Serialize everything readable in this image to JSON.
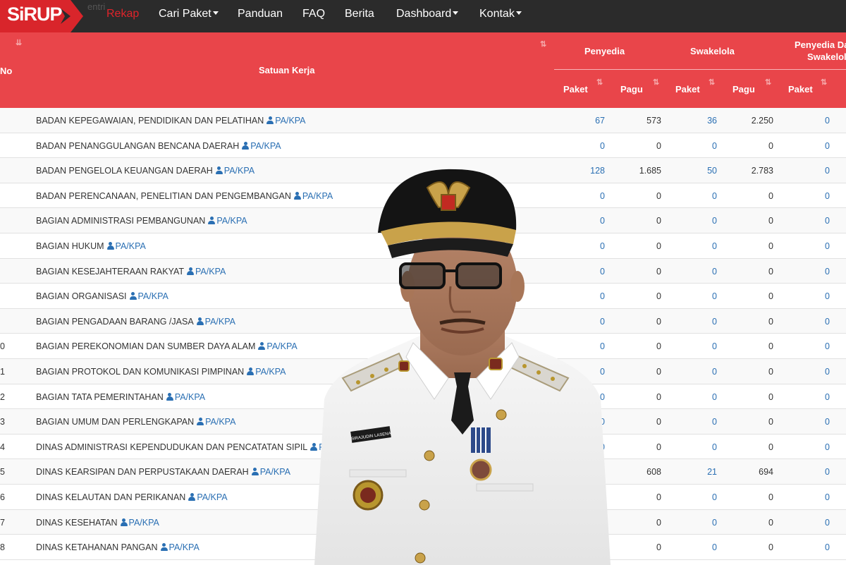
{
  "navbar": {
    "logo_text": "SiRUP",
    "ghost_text": "entri",
    "items": [
      {
        "label": "Rekap",
        "active": true,
        "dropdown": false
      },
      {
        "label": "Cari Paket",
        "active": false,
        "dropdown": true
      },
      {
        "label": "Panduan",
        "active": false,
        "dropdown": false
      },
      {
        "label": "FAQ",
        "active": false,
        "dropdown": false
      },
      {
        "label": "Berita",
        "active": false,
        "dropdown": false
      },
      {
        "label": "Dashboard",
        "active": false,
        "dropdown": true
      },
      {
        "label": "Kontak",
        "active": false,
        "dropdown": true
      }
    ]
  },
  "table": {
    "headers": {
      "no": "No",
      "satuan_kerja": "Satuan Kerja",
      "penyedia": "Penyedia",
      "swakelola": "Swakelola",
      "penyedia_dalam_1": "Penyedia Dal",
      "penyedia_dalam_2": "Swakelola",
      "paket": "Paket",
      "pagu": "Pagu"
    },
    "pa_kpa_label": "PA/KPA",
    "rows": [
      {
        "no": "",
        "name": "BADAN KEPEGAWAIAN, PENDIDIKAN DAN PELATIHAN",
        "p1": "67",
        "g1": "573",
        "p2": "36",
        "g2": "2.250",
        "p3": "0"
      },
      {
        "no": "",
        "name": "BADAN PENANGGULANGAN BENCANA DAERAH",
        "p1": "0",
        "g1": "0",
        "p2": "0",
        "g2": "0",
        "p3": "0"
      },
      {
        "no": "",
        "name": "BADAN PENGELOLA KEUANGAN DAERAH",
        "p1": "128",
        "g1": "1.685",
        "p2": "50",
        "g2": "2.783",
        "p3": "0"
      },
      {
        "no": "",
        "name": "BADAN PERENCANAAN, PENELITIAN DAN PENGEMBANGAN",
        "p1": "0",
        "g1": "0",
        "p2": "0",
        "g2": "0",
        "p3": "0"
      },
      {
        "no": "",
        "name": "BAGIAN ADMINISTRASI PEMBANGUNAN",
        "p1": "0",
        "g1": "0",
        "p2": "0",
        "g2": "0",
        "p3": "0"
      },
      {
        "no": "",
        "name": "BAGIAN HUKUM",
        "p1": "0",
        "g1": "0",
        "p2": "0",
        "g2": "0",
        "p3": "0"
      },
      {
        "no": "",
        "name": "BAGIAN KESEJAHTERAAN RAKYAT",
        "p1": "0",
        "g1": "0",
        "p2": "0",
        "g2": "0",
        "p3": "0"
      },
      {
        "no": "",
        "name": "BAGIAN ORGANISASI",
        "p1": "0",
        "g1": "0",
        "p2": "0",
        "g2": "0",
        "p3": "0"
      },
      {
        "no": "",
        "name": "BAGIAN PENGADAAN BARANG /JASA",
        "p1": "0",
        "g1": "0",
        "p2": "0",
        "g2": "0",
        "p3": "0"
      },
      {
        "no": "0",
        "name": "BAGIAN PEREKONOMIAN DAN SUMBER DAYA ALAM",
        "p1": "0",
        "g1": "0",
        "p2": "0",
        "g2": "0",
        "p3": "0"
      },
      {
        "no": "1",
        "name": "BAGIAN PROTOKOL DAN KOMUNIKASI PIMPINAN",
        "p1": "0",
        "g1": "0",
        "p2": "0",
        "g2": "0",
        "p3": "0"
      },
      {
        "no": "2",
        "name": "BAGIAN TATA PEMERINTAHAN",
        "p1": "0",
        "g1": "0",
        "p2": "0",
        "g2": "0",
        "p3": "0"
      },
      {
        "no": "3",
        "name": "BAGIAN UMUM DAN PERLENGKAPAN",
        "p1": "0",
        "g1": "0",
        "p2": "0",
        "g2": "0",
        "p3": "0"
      },
      {
        "no": "4",
        "name": "DINAS ADMINISTRASI KEPENDUDUKAN DAN PENCATATAN SIPIL",
        "p1": "0",
        "g1": "0",
        "p2": "0",
        "g2": "0",
        "p3": "0"
      },
      {
        "no": "5",
        "name": "DINAS KEARSIPAN DAN PERPUSTAKAAN DAERAH",
        "p1": "",
        "g1": "608",
        "p2": "21",
        "g2": "694",
        "p3": "0"
      },
      {
        "no": "6",
        "name": "DINAS KELAUTAN DAN PERIKANAN",
        "p1": "",
        "g1": "0",
        "p2": "0",
        "g2": "0",
        "p3": "0"
      },
      {
        "no": "7",
        "name": "DINAS KESEHATAN",
        "p1": "",
        "g1": "0",
        "p2": "0",
        "g2": "0",
        "p3": "0"
      },
      {
        "no": "8",
        "name": "DINAS KETAHANAN PANGAN",
        "p1": "",
        "g1": "0",
        "p2": "0",
        "g2": "0",
        "p3": "0"
      }
    ]
  },
  "portrait": {
    "name_tag": "SIRAJUDIN LASENA"
  },
  "colors": {
    "navbar_bg": "#2b2b2b",
    "header_red": "#e9454a",
    "link_blue": "#2a6fb3",
    "active_red": "#e0242b"
  }
}
